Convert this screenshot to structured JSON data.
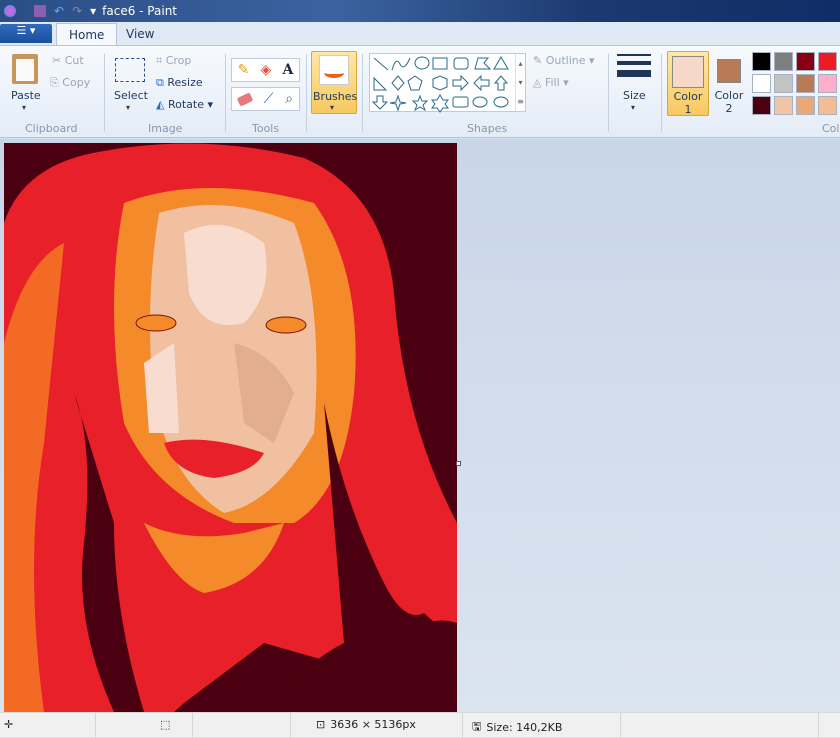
{
  "window": {
    "title": "face6 - Paint"
  },
  "tabs": [
    {
      "label": "Home",
      "active": true
    },
    {
      "label": "View",
      "active": false
    }
  ],
  "clipboard": {
    "paste": "Paste",
    "cut": "Cut",
    "copy": "Copy",
    "group": "Clipboard"
  },
  "image": {
    "select": "Select",
    "crop": "Crop",
    "resize": "Resize",
    "rotate": "Rotate",
    "group": "Image"
  },
  "tools": {
    "group": "Tools",
    "items": [
      "pencil-icon",
      "fill-icon",
      "text-icon",
      "eraser-icon",
      "color-picker-icon",
      "magnifier-icon"
    ]
  },
  "brushes": {
    "label": "Brushes"
  },
  "shapes": {
    "group": "Shapes",
    "outline": "Outline",
    "fill": "Fill"
  },
  "size": {
    "label": "Size"
  },
  "colors": {
    "color1_label": "Color",
    "color1_num": "1",
    "color2_label": "Color",
    "color2_num": "2",
    "group": "Col",
    "color1": "#f6d8c8",
    "color2": "#b97a57",
    "palette": [
      "#000000",
      "#7f7f7f",
      "#880015",
      "#ed1c24",
      "#ffffff",
      "#c3c3c3",
      "#b97a57",
      "#ffaec9",
      "#4a0010",
      "#f0c4a4",
      "#eaa878",
      "#f2bc94"
    ]
  },
  "status": {
    "dimensions": "3636 × 5136px",
    "size": "Size: 140,2KB"
  }
}
